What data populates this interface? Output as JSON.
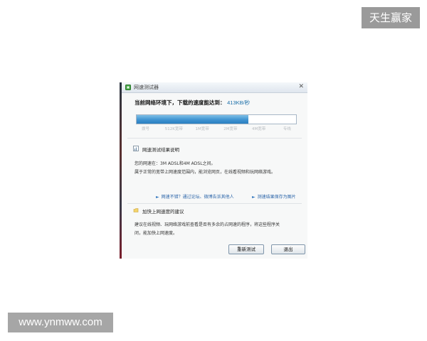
{
  "watermarks": {
    "top": "天生赢家",
    "bottom": "www.ynmww.com"
  },
  "window": {
    "title": "网速测试器",
    "close_glyph": "✕"
  },
  "result": {
    "prefix": "当前网络环境下，下载的速度能达到：",
    "speed": "413KB/秒"
  },
  "progress": {
    "fraction": 0.7,
    "ticks": [
      "拨号",
      "512K宽带",
      "1M宽带",
      "2M宽带",
      "4M宽带",
      "专线"
    ]
  },
  "explain": {
    "title": "网速测试结果说明",
    "line1": "您的网速在：3M ADSL和4M ADSL之间。",
    "line2": "属于正常的宽带上网速度范围内，能浏览网页，在线看视频和玩网络游戏。",
    "link1": "网速不错？通过论坛、微博告诉其他人",
    "link2": "测速结果保存为图片"
  },
  "advice": {
    "title": "加快上网速度的建议",
    "line1": "建议在线视频、玩网络游戏前查看是否有多余的占网速的程序，将这些程序关",
    "line2": "闭，能加快上网速度。"
  },
  "buttons": {
    "retest": "重新测试",
    "exit": "退出"
  },
  "icons": {
    "app": "app-icon",
    "chart": "chart-icon",
    "tip": "lightbulb-icon"
  },
  "colors": {
    "accent": "#3e93d1",
    "link": "#2a64a8",
    "speed": "#1a6ea8"
  }
}
